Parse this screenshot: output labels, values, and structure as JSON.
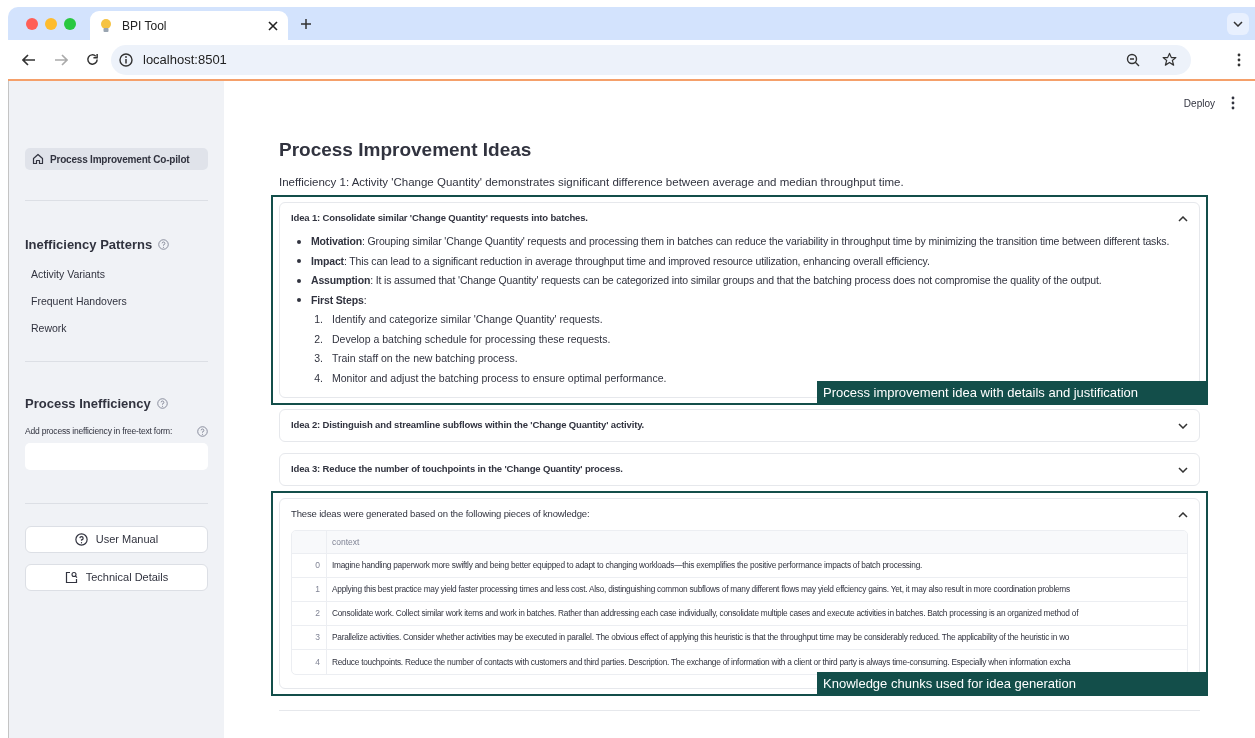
{
  "browser": {
    "tab_title": "BPI Tool",
    "url": "localhost:8501"
  },
  "app_header": {
    "deploy": "Deploy"
  },
  "sidebar": {
    "nav_item": {
      "label": "Process Improvement Co-pilot",
      "selected": true
    },
    "patterns": {
      "title": "Inefficiency Patterns",
      "items": [
        {
          "label": "Activity Variants"
        },
        {
          "label": "Frequent Handovers"
        },
        {
          "label": "Rework"
        }
      ]
    },
    "inefficiency": {
      "title": "Process Inefficiency",
      "field_label": "Add process inefficiency in free-text form:"
    },
    "buttons": [
      {
        "label": "User Manual",
        "kind": "help"
      },
      {
        "label": "Technical Details",
        "kind": "details"
      }
    ]
  },
  "main": {
    "title": "Process Improvement Ideas",
    "inefficiency": "Inefficiency 1: Activity 'Change Quantity' demonstrates significant difference between average and median throughput time.",
    "ideas": [
      {
        "title": "Idea 1: Consolidate similar 'Change Quantity' requests into batches.",
        "expanded": true,
        "points": [
          "**Motivation**: Grouping similar 'Change Quantity' requests and processing them in batches can reduce the variability in throughput time by minimizing the transition time between different tasks.",
          "**Impact**: This can lead to a significant reduction in average throughput time and improved resource utilization, enhancing overall efficiency.",
          "**Assumption**: It is assumed that 'Change Quantity' requests can be categorized into similar groups and that the batching process does not compromise the quality of the output.",
          "**First Steps**:"
        ],
        "steps": [
          {
            "number": "1.",
            "text": "Identify and categorize similar 'Change Quantity' requests."
          },
          {
            "number": "2.",
            "text": "Develop a batching schedule for processing these requests."
          },
          {
            "number": "3.",
            "text": "Train staff on the new batching process."
          },
          {
            "number": "4.",
            "text": "Monitor and adjust the batching process to ensure optimal performance."
          }
        ],
        "annotation": "Process improvement idea with details and justification"
      },
      {
        "title": "Idea 2: Distinguish and streamline subflows within the 'Change Quantity' activity.",
        "expanded": false
      },
      {
        "title": "Idea 3: Reduce the number of touchpoints in the 'Change Quantity' process.",
        "expanded": false
      }
    ],
    "knowledge": {
      "title": "These ideas were generated based on the following pieces of knowledge:",
      "expanded": true,
      "column": "context",
      "rows": [
        {
          "index": "0",
          "context": "Imagine handling paperwork more swiftly and being better equipped to adapt to changing workloads—this exemplifies the positive performance impacts of batch processing."
        },
        {
          "index": "1",
          "context": "Applying this best practice may yield faster processing times and less cost. Also, distinguishing common subflows of many different flows may yield effciency gains. Yet, it may also result in more coordination problems"
        },
        {
          "index": "2",
          "context": "Consolidate work. Collect similar work items and work in batches. Rather than addressing each case individually, consolidate multiple cases and execute activities in batches. Batch processing is an organized method of"
        },
        {
          "index": "3",
          "context": "Parallelize activities. Consider whether activities may be executed in parallel. The obvious effect of applying this heuristic is that the throughput time may be considerably reduced. The applicability of the heuristic in wo"
        },
        {
          "index": "4",
          "context": "Reduce touchpoints. Reduce the number of contacts with customers and third parties. Description. The exchange of information with a client or third party is always time-consuming. Especially when information excha"
        }
      ],
      "annotation": "Knowledge chunks used for idea generation"
    }
  }
}
